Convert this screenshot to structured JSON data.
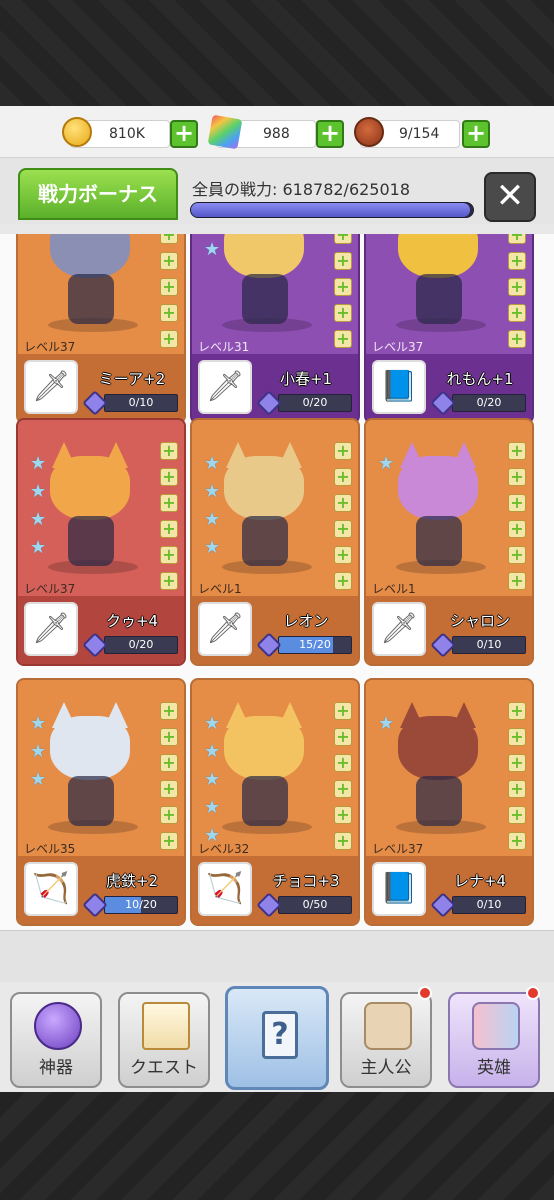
{
  "resources": {
    "gold": {
      "value": "810K",
      "icon": "gold-coin-icon"
    },
    "gems": {
      "value": "988",
      "icon": "rainbow-gem-icon"
    },
    "food": {
      "value": "9/154",
      "icon": "meat-icon"
    },
    "plus": "+"
  },
  "header": {
    "tab_label": "戦力ボーナス",
    "power_text": "全員の戦力: 618782/625018",
    "power_fraction": 0.99,
    "close_label": "✕"
  },
  "heroes": [
    {
      "name": "ミーア+2",
      "level": "レベル37",
      "progress": "0/10",
      "fill": 0,
      "color": "orange",
      "weapon": "sword-icon",
      "stars": 0,
      "hair": "#8b8fb4"
    },
    {
      "name": "小春+1",
      "level": "レベル31",
      "progress": "0/20",
      "fill": 0,
      "color": "purple",
      "weapon": "sword-icon",
      "stars": 2,
      "hair": "#f0c86a"
    },
    {
      "name": "れもん+1",
      "level": "レベル37",
      "progress": "0/20",
      "fill": 0,
      "color": "purple",
      "weapon": "spellbook-icon",
      "stars": 0,
      "hair": "#f0c040"
    },
    {
      "name": "クゥ+4",
      "level": "レベル37",
      "progress": "0/20",
      "fill": 0,
      "color": "red",
      "weapon": "sword-icon",
      "stars": 4,
      "hair": "#f1a64a"
    },
    {
      "name": "レオン",
      "level": "レベル1",
      "progress": "15/20",
      "fill": 0.75,
      "color": "orange",
      "weapon": "sword-icon",
      "stars": 4,
      "hair": "#e8c98a"
    },
    {
      "name": "シャロン",
      "level": "レベル1",
      "progress": "0/10",
      "fill": 0,
      "color": "orange",
      "weapon": "sword-icon",
      "stars": 1,
      "hair": "#c989d6"
    },
    {
      "name": "虎鉄+2",
      "level": "レベル35",
      "progress": "10/20",
      "fill": 0.5,
      "color": "orange",
      "weapon": "bow-icon",
      "stars": 3,
      "hair": "#dfe6ef"
    },
    {
      "name": "チョコ+3",
      "level": "レベル32",
      "progress": "0/50",
      "fill": 0,
      "color": "orange",
      "weapon": "bow-icon",
      "stars": 5,
      "hair": "#f2c360"
    },
    {
      "name": "レナ+4",
      "level": "レベル37",
      "progress": "0/10",
      "fill": 0,
      "color": "orange",
      "weapon": "spellbook-icon",
      "stars": 1,
      "hair": "#9b4a3a"
    }
  ],
  "nav": {
    "items": [
      {
        "label": "神器",
        "icon": "crystal-orb-icon"
      },
      {
        "label": "クエスト",
        "icon": "quest-scroll-icon"
      },
      {
        "label": "",
        "icon": "mystery-box-icon"
      },
      {
        "label": "主人公",
        "icon": "cat-face-icon"
      },
      {
        "label": "英雄",
        "icon": "hero-cats-icon"
      }
    ]
  }
}
